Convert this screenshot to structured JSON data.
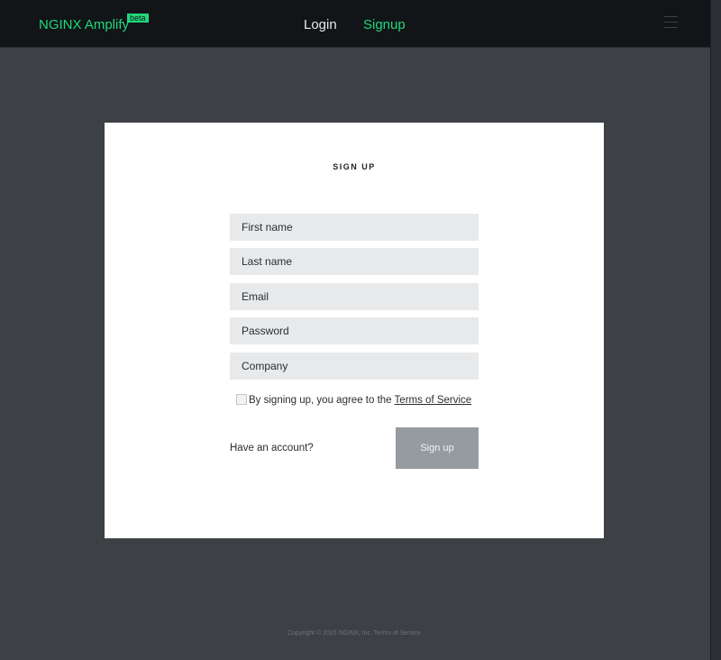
{
  "header": {
    "brand": "NGINX Amplify",
    "badge": "beta",
    "nav": {
      "login": "Login",
      "signup": "Signup"
    },
    "menu_icon": "hamburger-menu-icon"
  },
  "form": {
    "title": "SIGN UP",
    "fields": {
      "first_name": "First name",
      "last_name": "Last name",
      "email": "Email",
      "password": "Password",
      "company": "Company"
    },
    "terms_prefix": "By signing up, you agree to the ",
    "terms_link": "Terms of Service",
    "terms_checked": false,
    "have_account": "Have an account?",
    "submit": "Sign up"
  },
  "footer": {
    "copyright": "Copyright © 2015 NGINX, Inc. Terms of Service."
  },
  "colors": {
    "accent": "#21d77b",
    "topbar": "#111518",
    "background": "#3d4045",
    "card": "#ffffff",
    "input": "#e8e9ea",
    "button": "#969b9f"
  }
}
